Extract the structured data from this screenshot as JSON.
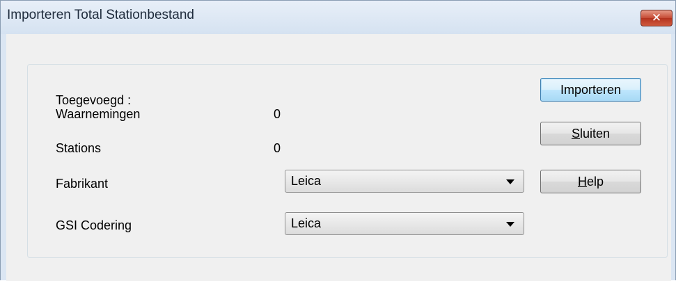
{
  "window": {
    "title": "Importeren Total Stationbestand",
    "close_glyph": "✕",
    "close_icon": "close-icon"
  },
  "form": {
    "added_label": "Toegevoegd :",
    "observations_label": "Waarnemingen",
    "observations_value": "0",
    "stations_label": "Stations",
    "stations_value": "0",
    "manufacturer_label": "Fabrikant",
    "manufacturer_value": "Leica",
    "gsi_label": "GSI Codering",
    "gsi_value": "Leica"
  },
  "buttons": {
    "import_label": "Importeren",
    "close_mnemonic": "S",
    "close_rest": "luiten",
    "help_mnemonic": "H",
    "help_rest": "elp"
  },
  "colors": {
    "title_bar": "#dbe6f3",
    "close_button": "#c54a34",
    "dialog_background": "#f0f0f0",
    "default_button_border": "#3c7fb1"
  }
}
